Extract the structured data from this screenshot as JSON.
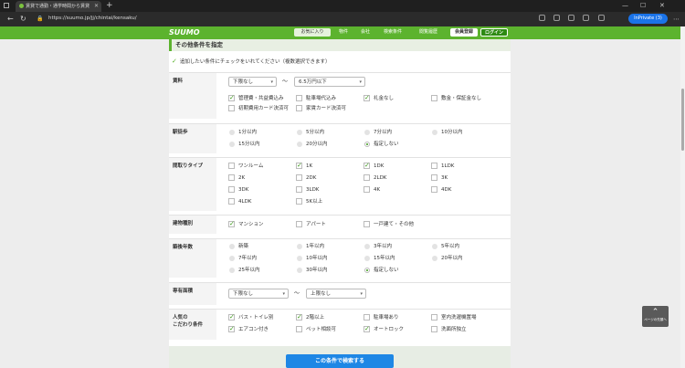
{
  "browser": {
    "tab_title": "賃貸で通勤・通学時間から賃貸",
    "url": "https://suumo.jp/jj/chintai/kensaku/",
    "profile_label": "InPrivate (3)"
  },
  "header": {
    "logo": "SUUMO",
    "favorites": "お気に入り",
    "property": "物件",
    "company": "会社",
    "search_conditions": "検索条件",
    "history": "閲覧履歴",
    "register": "会員登録",
    "login": "ログイン"
  },
  "section": {
    "title": "その他条件を指定",
    "instruction": "追加したい条件にチェックをいれてください（複数選択できます）"
  },
  "rows": {
    "rent": {
      "label": "賃料",
      "min": "下限なし",
      "max": "6.5万円以下",
      "tilde": "〜",
      "options": [
        {
          "label": "管理費・共益費込み",
          "checked": true
        },
        {
          "label": "駐車場代込み",
          "checked": false
        },
        {
          "label": "礼金なし",
          "checked": true
        },
        {
          "label": "敷金・保証金なし",
          "checked": false
        },
        {
          "label": "初期費用カード決済可",
          "checked": false
        },
        {
          "label": "家賃カード決済可",
          "checked": false
        }
      ]
    },
    "walk": {
      "label": "駅徒歩",
      "options": [
        {
          "label": "1分以内",
          "selected": false
        },
        {
          "label": "5分以内",
          "selected": false
        },
        {
          "label": "7分以内",
          "selected": false
        },
        {
          "label": "10分以内",
          "selected": false
        },
        {
          "label": "15分以内",
          "selected": false
        },
        {
          "label": "20分以内",
          "selected": false
        },
        {
          "label": "指定しない",
          "selected": true
        }
      ]
    },
    "layout": {
      "label": "間取りタイプ",
      "options": [
        {
          "label": "ワンルーム",
          "checked": false
        },
        {
          "label": "1K",
          "checked": true
        },
        {
          "label": "1DK",
          "checked": true
        },
        {
          "label": "1LDK",
          "checked": false
        },
        {
          "label": "2K",
          "checked": false
        },
        {
          "label": "2DK",
          "checked": false
        },
        {
          "label": "2LDK",
          "checked": false
        },
        {
          "label": "3K",
          "checked": false
        },
        {
          "label": "3DK",
          "checked": false
        },
        {
          "label": "3LDK",
          "checked": false
        },
        {
          "label": "4K",
          "checked": false
        },
        {
          "label": "4DK",
          "checked": false
        },
        {
          "label": "4LDK",
          "checked": false
        },
        {
          "label": "5K以上",
          "checked": false
        }
      ]
    },
    "building": {
      "label": "建物種別",
      "options": [
        {
          "label": "マンション",
          "checked": true
        },
        {
          "label": "アパート",
          "checked": false
        },
        {
          "label": "一戸建て・その他",
          "checked": false
        }
      ]
    },
    "age": {
      "label": "築後年数",
      "options": [
        {
          "label": "新築",
          "selected": false
        },
        {
          "label": "1年以内",
          "selected": false
        },
        {
          "label": "3年以内",
          "selected": false
        },
        {
          "label": "5年以内",
          "selected": false
        },
        {
          "label": "7年以内",
          "selected": false
        },
        {
          "label": "10年以内",
          "selected": false
        },
        {
          "label": "15年以内",
          "selected": false
        },
        {
          "label": "20年以内",
          "selected": false
        },
        {
          "label": "25年以内",
          "selected": false
        },
        {
          "label": "30年以内",
          "selected": false
        },
        {
          "label": "指定しない",
          "selected": true
        }
      ]
    },
    "area": {
      "label": "専有面積",
      "min": "下限なし",
      "max": "上限なし",
      "tilde": "〜"
    },
    "popular": {
      "label": "人気の\nこだわり条件",
      "options": [
        {
          "label": "バス・トイレ別",
          "checked": true
        },
        {
          "label": "2階以上",
          "checked": true
        },
        {
          "label": "駐車場あり",
          "checked": false
        },
        {
          "label": "室内洗濯機置場",
          "checked": false
        },
        {
          "label": "エアコン付き",
          "checked": true
        },
        {
          "label": "ペット相談可",
          "checked": false
        },
        {
          "label": "オートロック",
          "checked": true
        },
        {
          "label": "洗面所独立",
          "checked": false
        }
      ]
    }
  },
  "footer": {
    "submit": "この条件で検索する"
  },
  "to_top": "ページの先頭へ"
}
